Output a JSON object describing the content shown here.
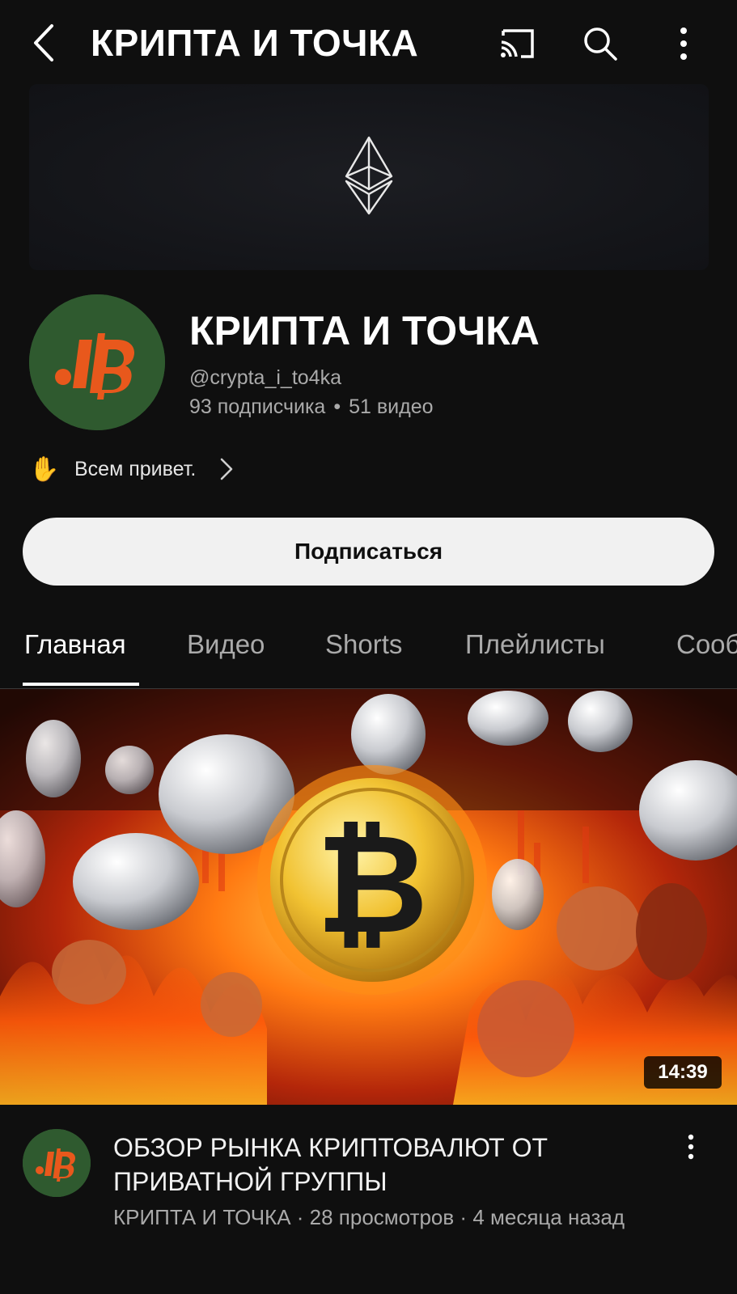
{
  "header": {
    "title": "КРИПТА И ТОЧКА",
    "back_icon": "chevron-left-icon",
    "cast_icon": "cast-icon",
    "search_icon": "search-icon",
    "more_icon": "more-vertical-icon"
  },
  "banner": {
    "icon": "ethereum-icon"
  },
  "channel": {
    "name": "КРИПТА И ТОЧКА",
    "handle": "@crypta_i_to4ka",
    "subscribers": "93 подписчика",
    "separator": "•",
    "videos": "51 видео",
    "description": "Всем привет.",
    "description_icon": "waving-hand-icon",
    "avatar_color": "#2f5a2f",
    "logo_color": "#e8581c"
  },
  "subscribe_button": {
    "label": "Подписаться"
  },
  "tabs": [
    {
      "label": "Главная",
      "active": true
    },
    {
      "label": "Видео",
      "active": false
    },
    {
      "label": "Shorts",
      "active": false
    },
    {
      "label": "Плейлисты",
      "active": false
    },
    {
      "label": "Сообщество",
      "active": false
    }
  ],
  "video": {
    "duration": "14:39",
    "title": "ОБЗОР РЫНКА КРИПТОВАЛЮТ ОТ ПРИВАТНОЙ ГРУППЫ",
    "channel": "КРИПТА И ТОЧКА",
    "views": "28 просмотров",
    "age": "4 месяца назад",
    "meta_separator": " · ",
    "more_icon": "more-vertical-icon"
  }
}
